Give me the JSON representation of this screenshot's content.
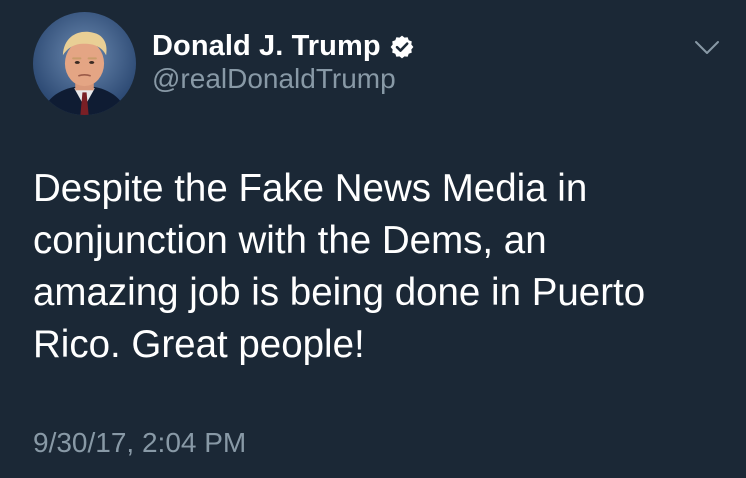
{
  "tweet": {
    "author": {
      "name": "Donald J. Trump",
      "handle": "@realDonaldTrump",
      "verified": true,
      "avatar": "profile-photo"
    },
    "text_lines": [
      "Despite the Fake News Media in",
      "conjunction with the Dems, an",
      "amazing job is being done in Puerto",
      "Rico. Great people!"
    ],
    "timestamp": "9/30/17, 2:04 PM",
    "menu_icon": "chevron-down-icon"
  },
  "colors": {
    "background": "#1b2836",
    "primary_text": "#ffffff",
    "secondary_text": "#8899a6",
    "verified_badge": "#ffffff"
  }
}
